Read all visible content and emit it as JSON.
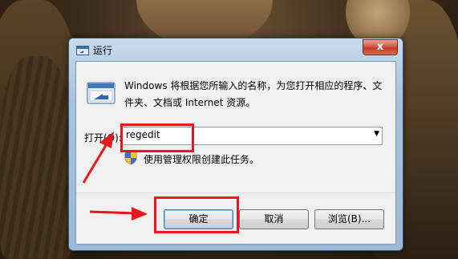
{
  "dialog": {
    "title": "运行",
    "close_label": "x",
    "description": "Windows 将根据您所输入的名称，为您打开相应的程序、文件夹、文档或 Internet 资源。",
    "open_label": "打开(O):",
    "command_value": "regedit",
    "admin_note": "使用管理权限创建此任务。",
    "buttons": {
      "ok": "确定",
      "cancel": "取消",
      "browse": "浏览(B)..."
    }
  },
  "icons": [
    "run-program-icon",
    "shield-icon",
    "chevron-down-icon",
    "close-icon"
  ],
  "colors": {
    "annotation_red": "#e8171e",
    "titlebar": "#a7c1da",
    "close_button": "#c23a2a"
  }
}
